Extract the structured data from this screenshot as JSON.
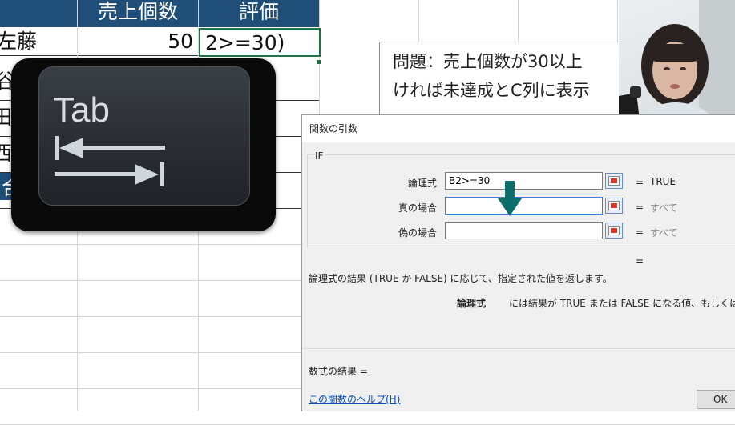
{
  "sheet": {
    "header_b": "売上個数",
    "header_c": "評価",
    "row2_a": "左藤",
    "row2_b": "50",
    "row2_c": "2>=30)",
    "row3_a": "谷",
    "row4_a": "田中",
    "row5_a": "西田",
    "row6_a": "合"
  },
  "problem": {
    "line1": "問題：売上個数が30以上",
    "line2": "ければ未達成とC列に表示"
  },
  "tab_key": {
    "label": "Tab"
  },
  "dialog": {
    "title": "関数の引数",
    "function_name": "IF",
    "args": [
      {
        "label": "論理式",
        "value": "B2>=30",
        "result": "TRUE"
      },
      {
        "label": "真の場合",
        "value": "",
        "result": "すべて"
      },
      {
        "label": "偽の場合",
        "value": "",
        "result": "すべて"
      }
    ],
    "equals": "=",
    "description": "論理式の結果 (TRUE か FALSE) に応じて、指定された値を返します。",
    "arg_desc_label": "論理式",
    "arg_desc": "には結果が TRUE または FALSE になる値、もしくは数",
    "formula_result_label": "数式の結果 =",
    "help_link": "この関数のヘルプ(H)",
    "ok_button": "OK"
  },
  "colors": {
    "header_bg": "#1f4e79",
    "active_cell_border": "#217346",
    "teal_arrow": "#0b6e6a",
    "link": "#0b4fb0"
  }
}
